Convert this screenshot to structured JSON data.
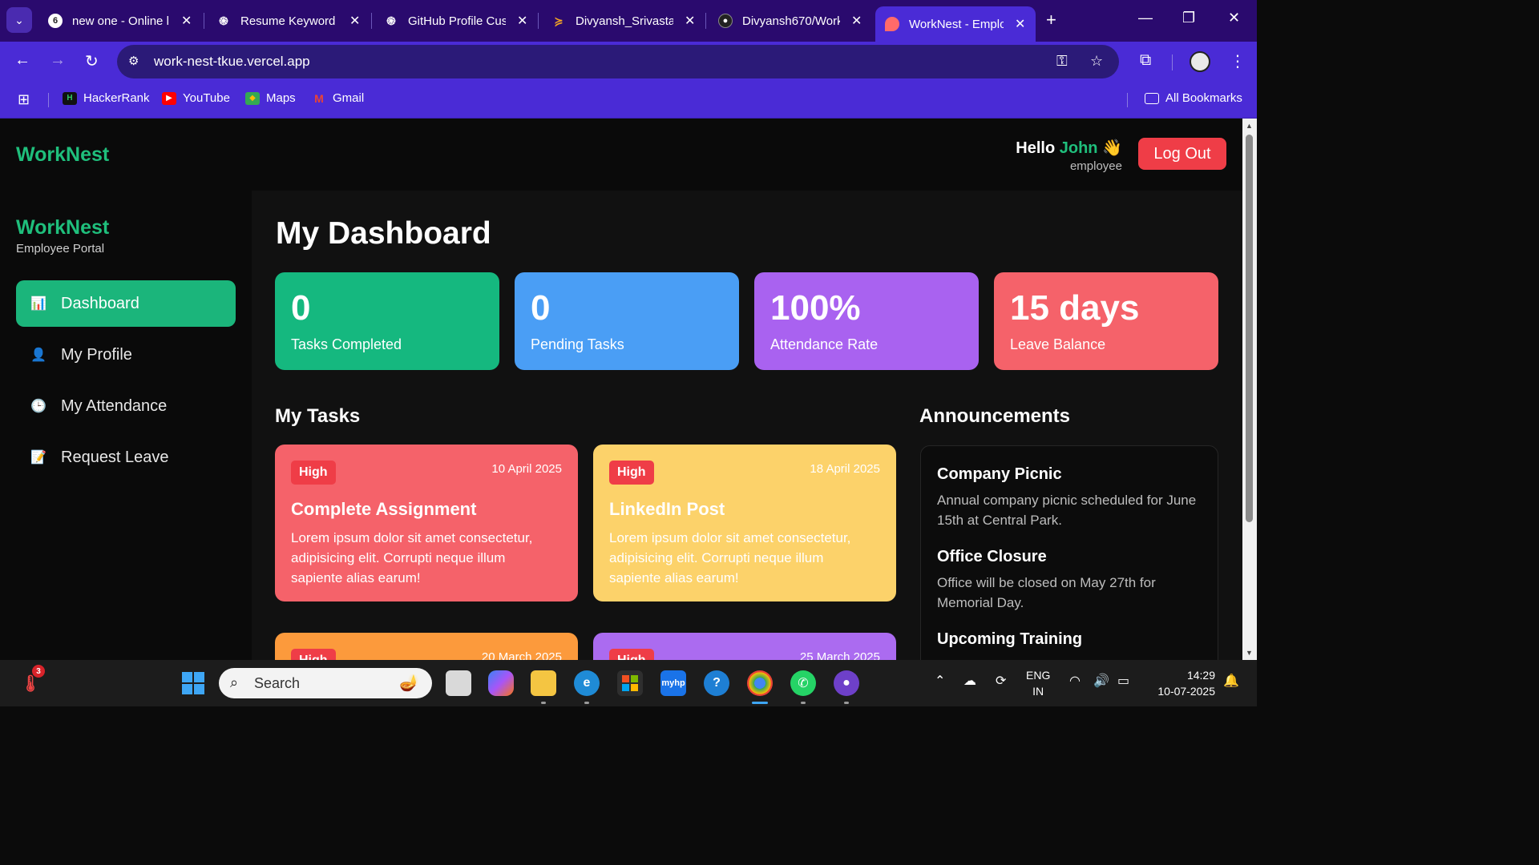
{
  "browser": {
    "tabs": [
      {
        "label": "new one - Online l",
        "icon": "online-gdb-icon"
      },
      {
        "label": "Resume Keyword C",
        "icon": "chatgpt-icon"
      },
      {
        "label": "GitHub Profile Cus",
        "icon": "chatgpt-icon"
      },
      {
        "label": "Divyansh_Srivastav",
        "icon": "vercel-icon"
      },
      {
        "label": "Divyansh670/Work",
        "icon": "github-icon"
      },
      {
        "label": "WorkNest - Emplo",
        "icon": "worknest-icon",
        "active": true
      }
    ],
    "url": "work-nest-tkue.vercel.app",
    "bookmarks": [
      {
        "label": "HackerRank"
      },
      {
        "label": "YouTube"
      },
      {
        "label": "Maps"
      },
      {
        "label": "Gmail"
      }
    ],
    "all_bookmarks": "All Bookmarks"
  },
  "app": {
    "brand": "WorkNest",
    "greeting": "Hello",
    "user_name": "John",
    "wave": "👋",
    "role": "employee",
    "logout_label": "Log Out"
  },
  "sidebar": {
    "brand": "WorkNest",
    "subtitle": "Employee Portal",
    "items": [
      {
        "label": "Dashboard",
        "icon": "chart-icon",
        "active": true
      },
      {
        "label": "My Profile",
        "icon": "user-icon"
      },
      {
        "label": "My Attendance",
        "icon": "clock-icon"
      },
      {
        "label": "Request Leave",
        "icon": "memo-icon"
      }
    ]
  },
  "dashboard": {
    "title": "My Dashboard",
    "stats": [
      {
        "value": "0",
        "label": "Tasks Completed",
        "color": "#15b87f"
      },
      {
        "value": "0",
        "label": "Pending Tasks",
        "color": "#4a9ef5"
      },
      {
        "value": "100%",
        "label": "Attendance Rate",
        "color": "#a962f0"
      },
      {
        "value": "15 days",
        "label": "Leave Balance",
        "color": "#f5626a"
      }
    ],
    "tasks_title": "My Tasks",
    "tasks": [
      {
        "priority": "High",
        "date": "10 April 2025",
        "title": "Complete Assignment",
        "description": "Lorem ipsum dolor sit amet consectetur, adipisicing elit. Corrupti neque illum sapiente alias earum!",
        "color": "#f5626a"
      },
      {
        "priority": "High",
        "date": "18 April 2025",
        "title": "LinkedIn Post",
        "description": "Lorem ipsum dolor sit amet consectetur, adipisicing elit. Corrupti neque illum sapiente alias earum!",
        "color": "#fcd26a"
      },
      {
        "priority": "High",
        "date": "20 March 2025",
        "title": "",
        "description": "",
        "color": "#fc9a3c"
      },
      {
        "priority": "High",
        "date": "25 March 2025",
        "title": "",
        "description": "",
        "color": "#ab6bf0"
      }
    ],
    "announcements_title": "Announcements",
    "announcements": [
      {
        "title": "Company Picnic",
        "text": "Annual company picnic scheduled for June 15th at Central Park."
      },
      {
        "title": "Office Closure",
        "text": "Office will be closed on May 27th for Memorial Day."
      },
      {
        "title": "Upcoming Training",
        "text": ""
      }
    ]
  },
  "taskbar": {
    "search_placeholder": "Search",
    "notification_count": "3",
    "lang_line1": "ENG",
    "lang_line2": "IN",
    "time": "14:29",
    "date": "10-07-2025"
  }
}
